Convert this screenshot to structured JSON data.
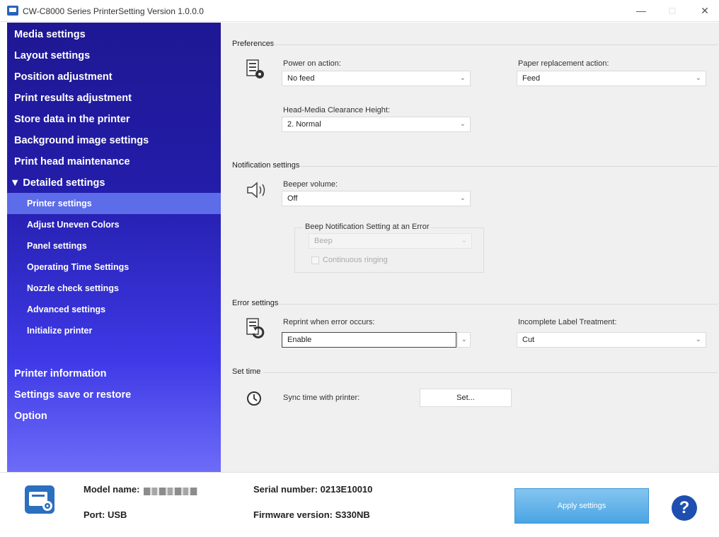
{
  "window": {
    "title": "CW-C8000 Series PrinterSetting Version 1.0.0.0",
    "minimize": "—",
    "maximize": "□",
    "close": "✕"
  },
  "sidebar": {
    "items": [
      {
        "label": "Media settings"
      },
      {
        "label": "Layout settings"
      },
      {
        "label": "Position adjustment"
      },
      {
        "label": "Print results adjustment"
      },
      {
        "label": "Store data in the printer"
      },
      {
        "label": "Background image settings"
      },
      {
        "label": "Print head maintenance"
      },
      {
        "label": "▼ Detailed settings"
      }
    ],
    "subitems": [
      {
        "label": "Printer settings"
      },
      {
        "label": "Adjust Uneven Colors"
      },
      {
        "label": "Panel settings"
      },
      {
        "label": "Operating Time Settings"
      },
      {
        "label": "Nozzle check settings"
      },
      {
        "label": "Advanced settings"
      },
      {
        "label": "Initialize printer"
      }
    ],
    "bottom_items": [
      {
        "label": "Printer information"
      },
      {
        "label": "Settings save or restore"
      },
      {
        "label": "Option"
      }
    ]
  },
  "preferences": {
    "group_label": "Preferences",
    "power_on_label": "Power on action:",
    "power_on_value": "No feed",
    "paper_replacement_label": "Paper replacement action:",
    "paper_replacement_value": "Feed",
    "head_clearance_label": "Head-Media Clearance Height:",
    "head_clearance_value": "2. Normal"
  },
  "notification": {
    "group_label": "Notification settings",
    "beeper_label": "Beeper volume:",
    "beeper_value": "Off",
    "beep_error_label": "Beep Notification Setting at an Error",
    "beep_error_value": "Beep",
    "continuous_label": "Continuous ringing"
  },
  "error": {
    "group_label": "Error settings",
    "reprint_label": "Reprint when error occurs:",
    "reprint_value": "Enable",
    "incomplete_label": "Incomplete Label Treatment:",
    "incomplete_value": "Cut"
  },
  "settime": {
    "group_label": "Set time",
    "sync_label": "Sync time with printer:",
    "set_button": "Set..."
  },
  "footer": {
    "model_label": "Model name:",
    "port_label": "Port: USB",
    "serial_label": "Serial number: 0213E10010",
    "firmware_label": "Firmware version: S330NB",
    "apply_button": "Apply settings",
    "help_symbol": "?"
  },
  "icons": {
    "app": "printer-app-icon",
    "power_on": "printer-gear-icon",
    "beeper": "speaker-icon",
    "reprint": "printer-reprint-icon",
    "clock": "clock-icon",
    "footer_printer": "printer-settings-icon",
    "help": "help-icon"
  },
  "colors": {
    "sidebar_top": "#1f1893",
    "sidebar_bottom": "#6d6cf8",
    "selected_item": "#5d6ce9",
    "apply_button": "#4aa4e4",
    "help_button": "#1e4fb0"
  }
}
